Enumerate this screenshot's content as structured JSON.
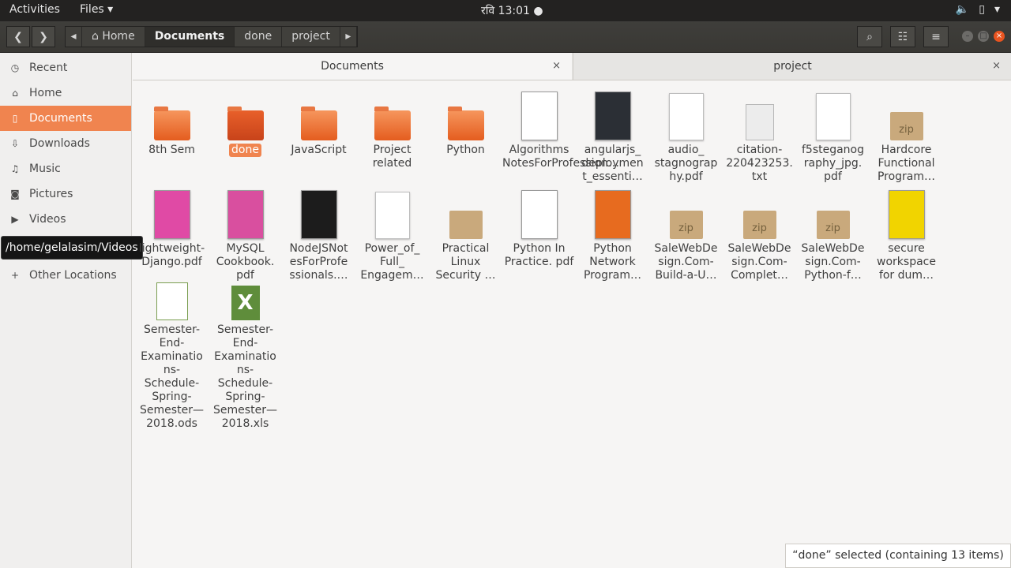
{
  "topbar": {
    "activities": "Activities",
    "app_menu": "Files ▾",
    "clock": "रवि 13:01 ●",
    "sys_icons": [
      "volume-icon",
      "battery-icon",
      "power-icon"
    ]
  },
  "breadcrumb": {
    "home": "⌂ Home",
    "items": [
      "Documents",
      "done",
      "project"
    ]
  },
  "sidebar": {
    "items": [
      {
        "label": "Recent",
        "icon": "clock-icon"
      },
      {
        "label": "Home",
        "icon": "home-icon"
      },
      {
        "label": "Documents",
        "icon": "document-icon"
      },
      {
        "label": "Downloads",
        "icon": "download-icon"
      },
      {
        "label": "Music",
        "icon": "music-icon"
      },
      {
        "label": "Pictures",
        "icon": "camera-icon"
      },
      {
        "label": "Videos",
        "icon": "video-icon"
      }
    ],
    "other_locations": "Other Locations",
    "tooltip": "/home/gelalasim/Videos"
  },
  "tabs": [
    {
      "label": "Documents"
    },
    {
      "label": "project"
    }
  ],
  "files": [
    {
      "name": "8th Sem",
      "type": "folder"
    },
    {
      "name": "done",
      "type": "folder-selected"
    },
    {
      "name": "JavaScript",
      "type": "folder"
    },
    {
      "name": "Project related",
      "type": "folder"
    },
    {
      "name": "Python",
      "type": "folder"
    },
    {
      "name": "Algorithms NotesForProfession…",
      "type": "book"
    },
    {
      "name": "angularjs_ deploymen t_essenti…",
      "type": "book"
    },
    {
      "name": "audio_ stagnograp hy.pdf",
      "type": "doc"
    },
    {
      "name": "citation- 220423253. txt",
      "type": "txt"
    },
    {
      "name": "f5steganog raphy_jpg. pdf",
      "type": "doc"
    },
    {
      "name": "Hardcore Functional Program…",
      "type": "zip"
    },
    {
      "name": "lightweight-Django.pdf",
      "type": "book"
    },
    {
      "name": "MySQL Cookbook. pdf",
      "type": "book"
    },
    {
      "name": "NodeJSNot esForProfe ssionals.…",
      "type": "book"
    },
    {
      "name": "Power_of_ Full_ Engagem…",
      "type": "doc"
    },
    {
      "name": "Practical Linux Security …",
      "type": "zip"
    },
    {
      "name": "Python In Practice. pdf",
      "type": "book"
    },
    {
      "name": "Python Network Program…",
      "type": "book"
    },
    {
      "name": "SaleWebDe sign.Com- Build-a-U…",
      "type": "zip"
    },
    {
      "name": "SaleWebDe sign.Com- Complet…",
      "type": "zip"
    },
    {
      "name": "SaleWebDe sign.Com- Python-f…",
      "type": "zip"
    },
    {
      "name": "secure workspace for dum…",
      "type": "book"
    },
    {
      "name": "Semester- End- Examinatio ns- Schedule- Spring- Semester— 2018.ods",
      "type": "sheet"
    },
    {
      "name": "Semester- End- Examinatio ns- Schedule- Spring- Semester— 2018.xls",
      "type": "xls"
    }
  ],
  "status": "“done” selected  (containing 13 items)"
}
